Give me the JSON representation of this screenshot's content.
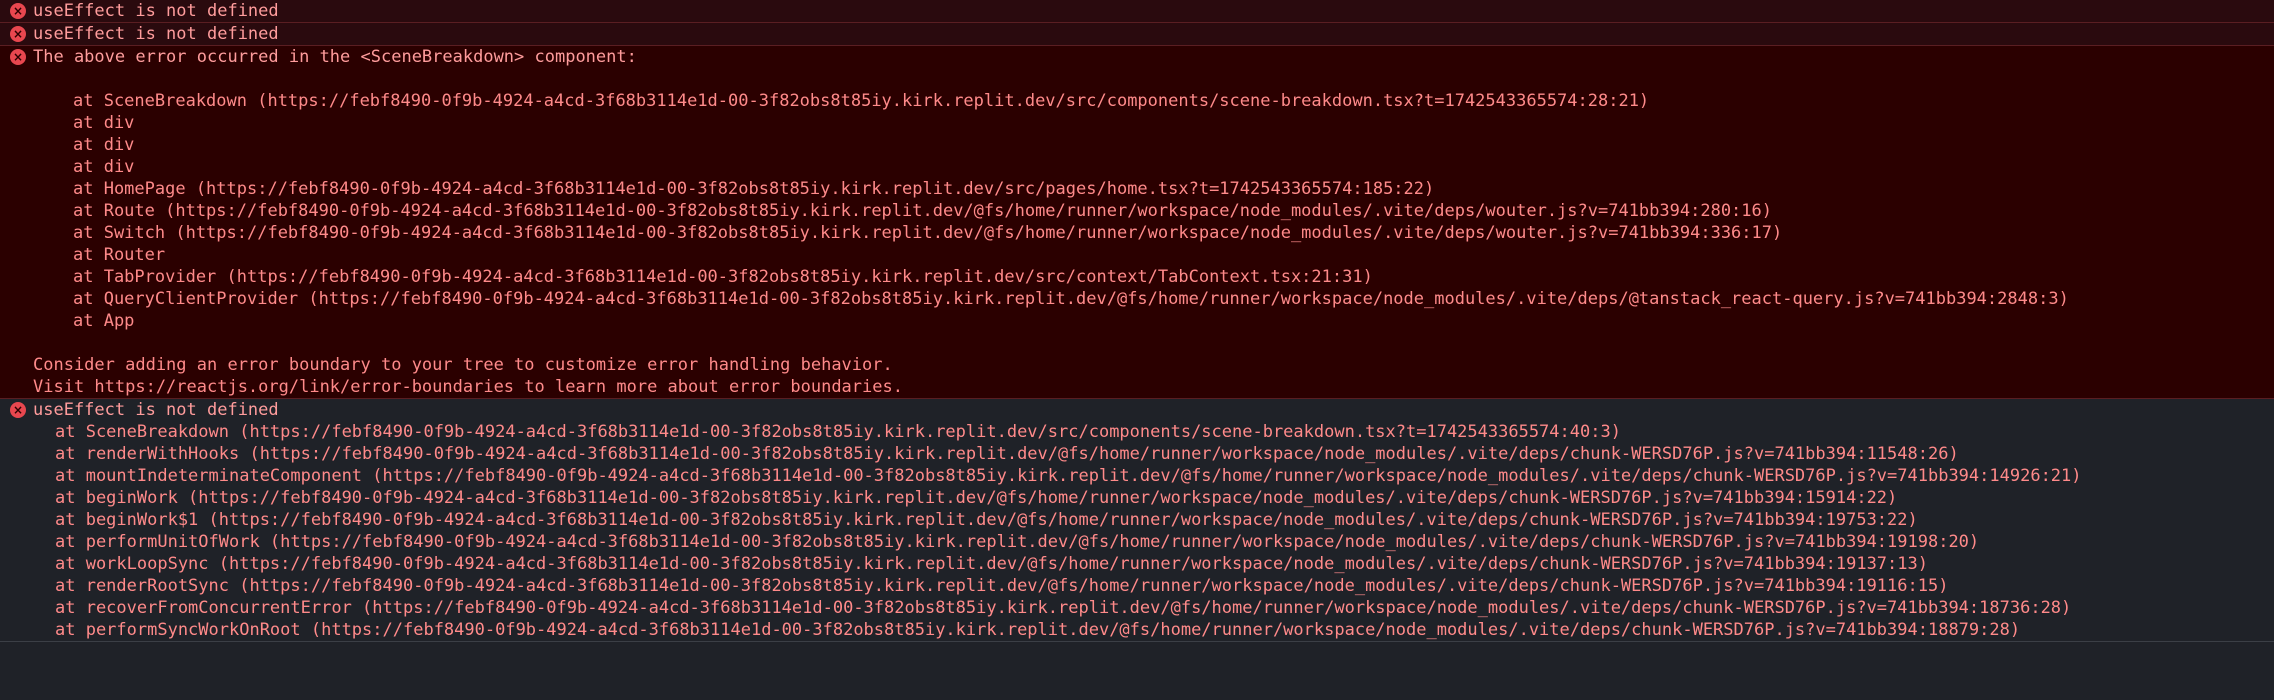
{
  "errors": [
    {
      "icon": "error-circle-icon",
      "message": "useEffect is not defined"
    },
    {
      "icon": "error-circle-icon",
      "message": "useEffect is not defined"
    }
  ],
  "component_error": {
    "icon": "error-circle-icon",
    "message": "The above error occurred in the <SceneBreakdown> component:",
    "stack": [
      "at SceneBreakdown (https://febf8490-0f9b-4924-a4cd-3f68b3114e1d-00-3f82obs8t85iy.kirk.replit.dev/src/components/scene-breakdown.tsx?t=1742543365574:28:21)",
      "at div",
      "at div",
      "at div",
      "at HomePage (https://febf8490-0f9b-4924-a4cd-3f68b3114e1d-00-3f82obs8t85iy.kirk.replit.dev/src/pages/home.tsx?t=1742543365574:185:22)",
      "at Route (https://febf8490-0f9b-4924-a4cd-3f68b3114e1d-00-3f82obs8t85iy.kirk.replit.dev/@fs/home/runner/workspace/node_modules/.vite/deps/wouter.js?v=741bb394:280:16)",
      "at Switch (https://febf8490-0f9b-4924-a4cd-3f68b3114e1d-00-3f82obs8t85iy.kirk.replit.dev/@fs/home/runner/workspace/node_modules/.vite/deps/wouter.js?v=741bb394:336:17)",
      "at Router",
      "at TabProvider (https://febf8490-0f9b-4924-a4cd-3f68b3114e1d-00-3f82obs8t85iy.kirk.replit.dev/src/context/TabContext.tsx:21:31)",
      "at QueryClientProvider (https://febf8490-0f9b-4924-a4cd-3f68b3114e1d-00-3f82obs8t85iy.kirk.replit.dev/@fs/home/runner/workspace/node_modules/.vite/deps/@tanstack_react-query.js?v=741bb394:2848:3)",
      "at App"
    ],
    "advice_1": "Consider adding an error boundary to your tree to customize error handling behavior.",
    "advice_2": "Visit https://reactjs.org/link/error-boundaries to learn more about error boundaries."
  },
  "last_error": {
    "icon": "error-circle-icon",
    "message": "useEffect is not defined",
    "stack": [
      "at SceneBreakdown (https://febf8490-0f9b-4924-a4cd-3f68b3114e1d-00-3f82obs8t85iy.kirk.replit.dev/src/components/scene-breakdown.tsx?t=1742543365574:40:3)",
      "at renderWithHooks (https://febf8490-0f9b-4924-a4cd-3f68b3114e1d-00-3f82obs8t85iy.kirk.replit.dev/@fs/home/runner/workspace/node_modules/.vite/deps/chunk-WERSD76P.js?v=741bb394:11548:26)",
      "at mountIndeterminateComponent (https://febf8490-0f9b-4924-a4cd-3f68b3114e1d-00-3f82obs8t85iy.kirk.replit.dev/@fs/home/runner/workspace/node_modules/.vite/deps/chunk-WERSD76P.js?v=741bb394:14926:21)",
      "at beginWork (https://febf8490-0f9b-4924-a4cd-3f68b3114e1d-00-3f82obs8t85iy.kirk.replit.dev/@fs/home/runner/workspace/node_modules/.vite/deps/chunk-WERSD76P.js?v=741bb394:15914:22)",
      "at beginWork$1 (https://febf8490-0f9b-4924-a4cd-3f68b3114e1d-00-3f82obs8t85iy.kirk.replit.dev/@fs/home/runner/workspace/node_modules/.vite/deps/chunk-WERSD76P.js?v=741bb394:19753:22)",
      "at performUnitOfWork (https://febf8490-0f9b-4924-a4cd-3f68b3114e1d-00-3f82obs8t85iy.kirk.replit.dev/@fs/home/runner/workspace/node_modules/.vite/deps/chunk-WERSD76P.js?v=741bb394:19198:20)",
      "at workLoopSync (https://febf8490-0f9b-4924-a4cd-3f68b3114e1d-00-3f82obs8t85iy.kirk.replit.dev/@fs/home/runner/workspace/node_modules/.vite/deps/chunk-WERSD76P.js?v=741bb394:19137:13)",
      "at renderRootSync (https://febf8490-0f9b-4924-a4cd-3f68b3114e1d-00-3f82obs8t85iy.kirk.replit.dev/@fs/home/runner/workspace/node_modules/.vite/deps/chunk-WERSD76P.js?v=741bb394:19116:15)",
      "at recoverFromConcurrentError (https://febf8490-0f9b-4924-a4cd-3f68b3114e1d-00-3f82obs8t85iy.kirk.replit.dev/@fs/home/runner/workspace/node_modules/.vite/deps/chunk-WERSD76P.js?v=741bb394:18736:28)",
      "at performSyncWorkOnRoot (https://febf8490-0f9b-4924-a4cd-3f68b3114e1d-00-3f82obs8t85iy.kirk.replit.dev/@fs/home/runner/workspace/node_modules/.vite/deps/chunk-WERSD76P.js?v=741bb394:18879:28)"
    ]
  },
  "colors": {
    "error_bg": "#2b0000",
    "error_text": "#ff8a8a",
    "icon": "#e8474f",
    "panel_bg": "#1f2228"
  }
}
